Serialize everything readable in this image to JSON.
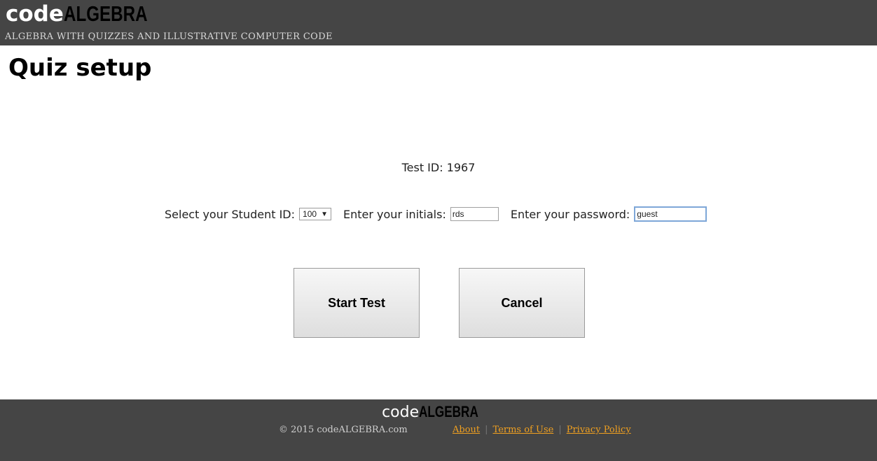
{
  "header": {
    "logo_part1": "code",
    "logo_part2": "ALGEBRA",
    "tagline": "ALGEBRA WITH QUIZZES AND ILLUSTRATIVE COMPUTER CODE"
  },
  "page": {
    "title": "Quiz setup",
    "test_id_text": "Test ID: 1967"
  },
  "form": {
    "student_id_label": "Select your Student ID:",
    "student_id_value": "100",
    "initials_label": "Enter your initials:",
    "initials_value": "rds",
    "password_label": "Enter your password:",
    "password_value": "guest"
  },
  "buttons": {
    "start_label": "Start Test",
    "cancel_label": "Cancel"
  },
  "footer": {
    "logo_part1": "code",
    "logo_part2": "ALGEBRA",
    "copyright": "© 2015 codeALGEBRA.com",
    "links": [
      "About",
      "Terms of Use",
      "Privacy Policy"
    ]
  },
  "colors": {
    "bar": "#454545",
    "link": "#f0a020"
  }
}
